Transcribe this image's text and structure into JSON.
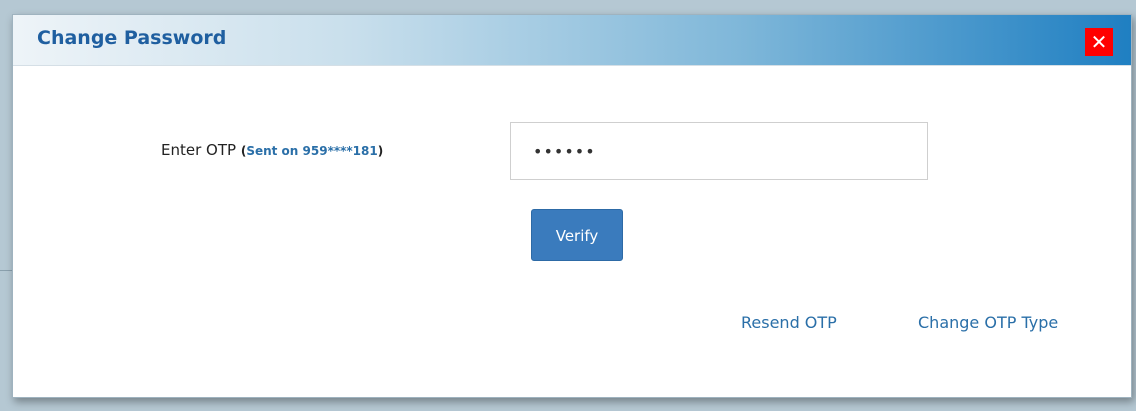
{
  "dialog": {
    "title": "Change Password",
    "close_label": "✕"
  },
  "otp": {
    "label": "Enter OTP",
    "sent_open": "(",
    "sent_text": "Sent on 959****181",
    "sent_close": ")",
    "value": "••••••"
  },
  "actions": {
    "verify_label": "Verify",
    "resend_label": "Resend OTP",
    "change_type_label": "Change OTP Type"
  },
  "colors": {
    "title": "#1f5fa0",
    "close_bg": "#ff0000",
    "verify_bg": "#3a7bbd",
    "link": "#2a6fa8"
  }
}
